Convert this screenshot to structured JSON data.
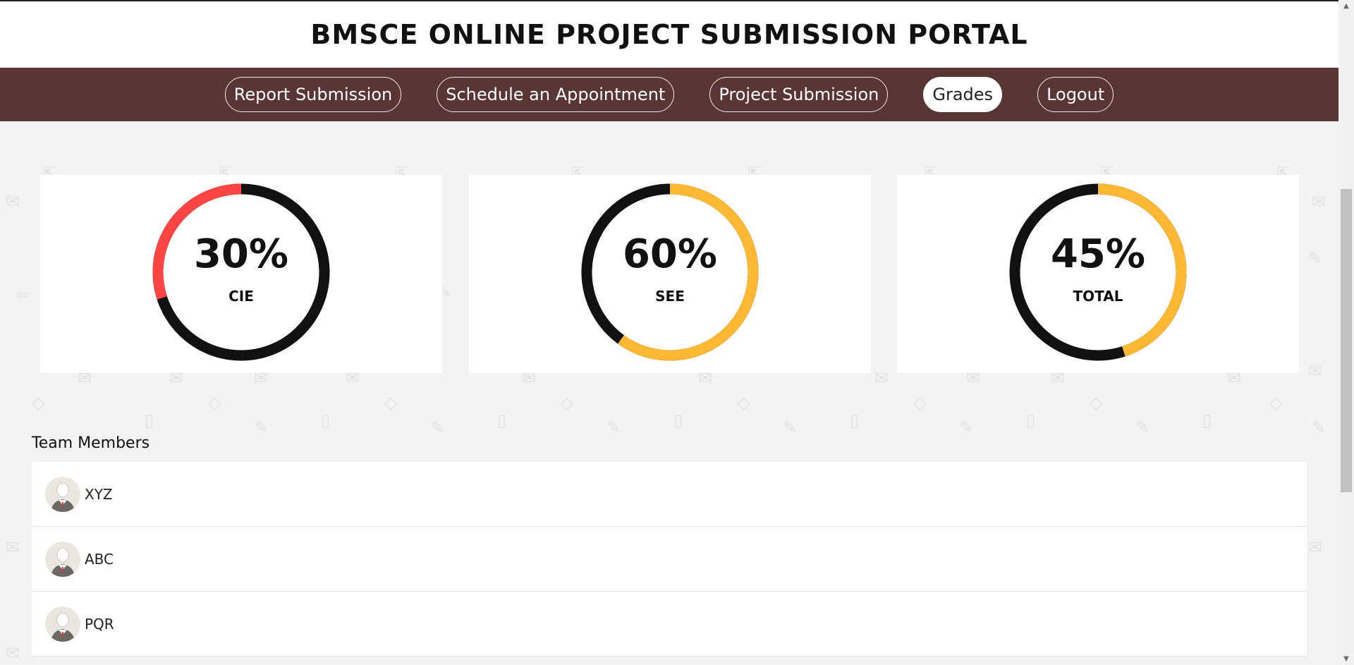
{
  "header": {
    "title": "BMSCE ONLINE PROJECT SUBMISSION PORTAL"
  },
  "nav": {
    "items": [
      {
        "label": "Report Submission",
        "active": false
      },
      {
        "label": "Schedule an Appointment",
        "active": false
      },
      {
        "label": "Project Submission",
        "active": false
      },
      {
        "label": "Grades",
        "active": true
      },
      {
        "label": "Logout",
        "active": false
      }
    ]
  },
  "grades": [
    {
      "value": "30%",
      "label": "CIE",
      "percent": 30,
      "color": "#ff4444",
      "track_color": "#111111",
      "arc": "counterclockwise"
    },
    {
      "value": "60%",
      "label": "SEE",
      "percent": 60,
      "color": "#ffb833",
      "track_color": "#111111",
      "arc": "clockwise"
    },
    {
      "value": "45%",
      "label": "TOTAL",
      "percent": 45,
      "color": "#ffb833",
      "track_color": "#111111",
      "arc": "clockwise"
    }
  ],
  "team": {
    "title": "Team Members",
    "members": [
      {
        "name": "XYZ",
        "icon": "avatar-icon"
      },
      {
        "name": "ABC",
        "icon": "avatar-icon"
      },
      {
        "name": "PQR",
        "icon": "avatar-icon"
      }
    ]
  },
  "colors": {
    "nav_bg": "#5a3535",
    "page_bg": "#f3f3f3",
    "accent_red": "#ff4444",
    "accent_orange": "#ffb833"
  }
}
